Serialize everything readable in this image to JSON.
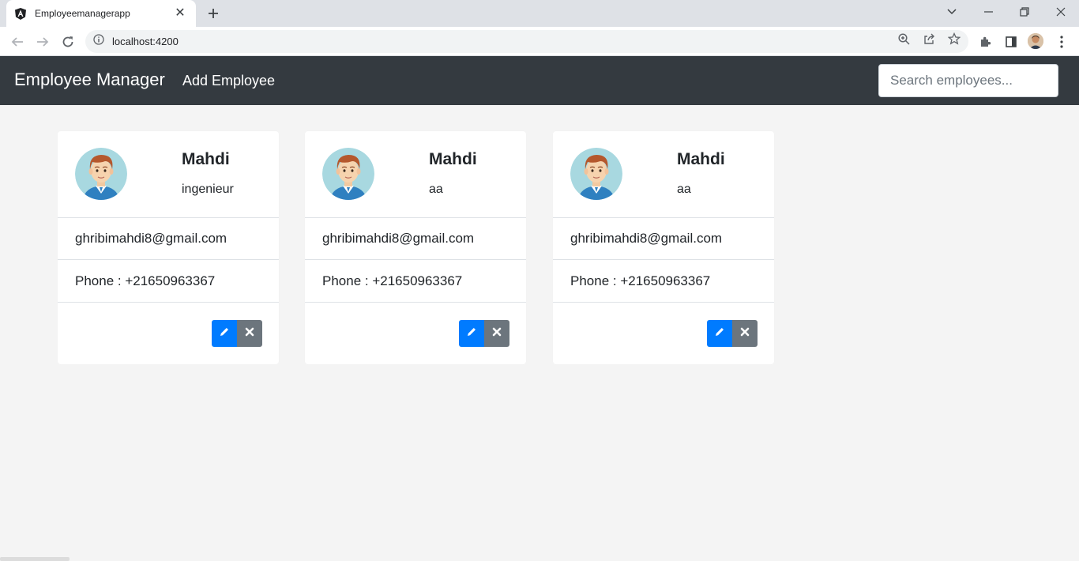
{
  "browser": {
    "tab_title": "Employeemanagerapp",
    "url": "localhost:4200"
  },
  "app": {
    "brand": "Employee Manager",
    "nav_add": "Add Employee",
    "search_placeholder": "Search employees..."
  },
  "employees": [
    {
      "name": "Mahdi",
      "job": "ingenieur",
      "email": "ghribimahdi8@gmail.com",
      "phone": "Phone : +21650963367"
    },
    {
      "name": "Mahdi",
      "job": "aa",
      "email": "ghribimahdi8@gmail.com",
      "phone": "Phone : +21650963367"
    },
    {
      "name": "Mahdi",
      "job": "aa",
      "email": "ghribimahdi8@gmail.com",
      "phone": "Phone : +21650963367"
    }
  ],
  "colors": {
    "navbar": "#343a40",
    "edit_button": "#007bff",
    "delete_button": "#6c757d",
    "page_bg": "#f4f4f4"
  }
}
